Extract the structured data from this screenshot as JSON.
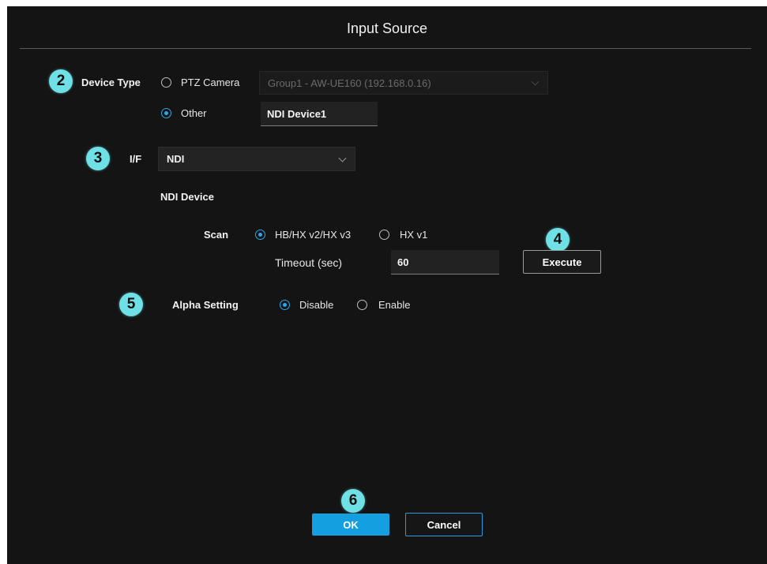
{
  "dialog": {
    "title": "Input Source"
  },
  "badges": {
    "device_type": "2",
    "interface": "3",
    "execute": "4",
    "alpha": "5",
    "ok": "6"
  },
  "device_type": {
    "label": "Device Type",
    "options": [
      {
        "label": "PTZ Camera",
        "selected": false
      },
      {
        "label": "Other",
        "selected": true
      }
    ],
    "ptz_select_value": "Group1 - AW-UE160 (192.168.0.16)",
    "other_name_value": "NDI Device1"
  },
  "interface": {
    "label": "I/F",
    "value": "NDI"
  },
  "ndi_device": {
    "heading": "NDI Device",
    "scan_label": "Scan",
    "scan_options": [
      {
        "label": "HB/HX v2/HX v3",
        "selected": true
      },
      {
        "label": "HX v1",
        "selected": false
      }
    ],
    "timeout_label": "Timeout (sec)",
    "timeout_value": "60",
    "execute_label": "Execute"
  },
  "alpha": {
    "label": "Alpha Setting",
    "options": [
      {
        "label": "Disable",
        "selected": true
      },
      {
        "label": "Enable",
        "selected": false
      }
    ]
  },
  "footer": {
    "ok_label": "OK",
    "cancel_label": "Cancel"
  },
  "colors": {
    "accent": "#14a0e0",
    "badge": "#6ee0e6",
    "background": "#141414"
  }
}
